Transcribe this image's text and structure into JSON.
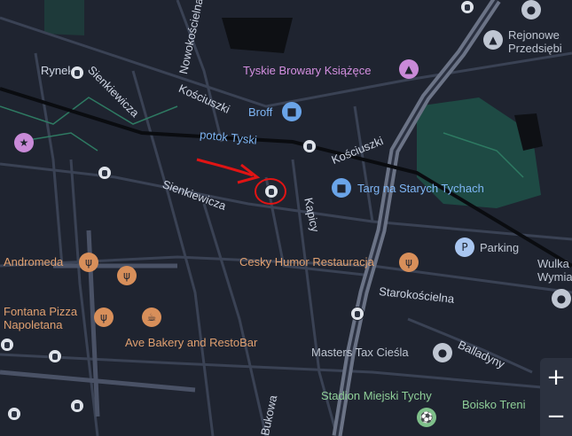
{
  "streets": {
    "rynek": "Rynek",
    "sienkiewicza_upper": "Sienkiewicza",
    "nowokoscielna": "Nowokościelna",
    "kosciuszki_left": "Kościuszki",
    "kosciuszki_right": "Kościuszki",
    "potok": "potok Tyski",
    "sienkiewicza_lower": "Sienkiewicza",
    "kapicy": "Kapicy",
    "starokoscielna": "Starokościelna",
    "balladyny": "Balladyny",
    "bukowa": "Bukowa"
  },
  "pois": {
    "tyskie": "Tyskie Browary Książęce",
    "broff": "Broff",
    "rejonowe_line1": "Rejonowe",
    "rejonowe_line2": "Przedsiębi",
    "targ": "Targ na Starych Tychach",
    "parking": "Parking",
    "wulka_line1": "Wulka",
    "wulka_line2": "Wymia",
    "andromeda": "Andromeda",
    "cesky": "Cesky Humor Restauracja",
    "fontana_line1": "Fontana Pizza",
    "fontana_line2": "Napoletana",
    "ave": "Ave Bakery and RestoBar",
    "masters": "Masters Tax Cieśla",
    "stadion": "Stadion Miejski Tychy",
    "boisko": "Boisko Treni"
  },
  "colors": {
    "background": "#1f2430",
    "road": "#3a4254",
    "major_road": "#6b7386",
    "rail": "#0a0c10",
    "park": "#1e4a44",
    "annotation_red": "#e01414"
  },
  "controls": {
    "zoom_in": "+",
    "zoom_out": "−"
  }
}
